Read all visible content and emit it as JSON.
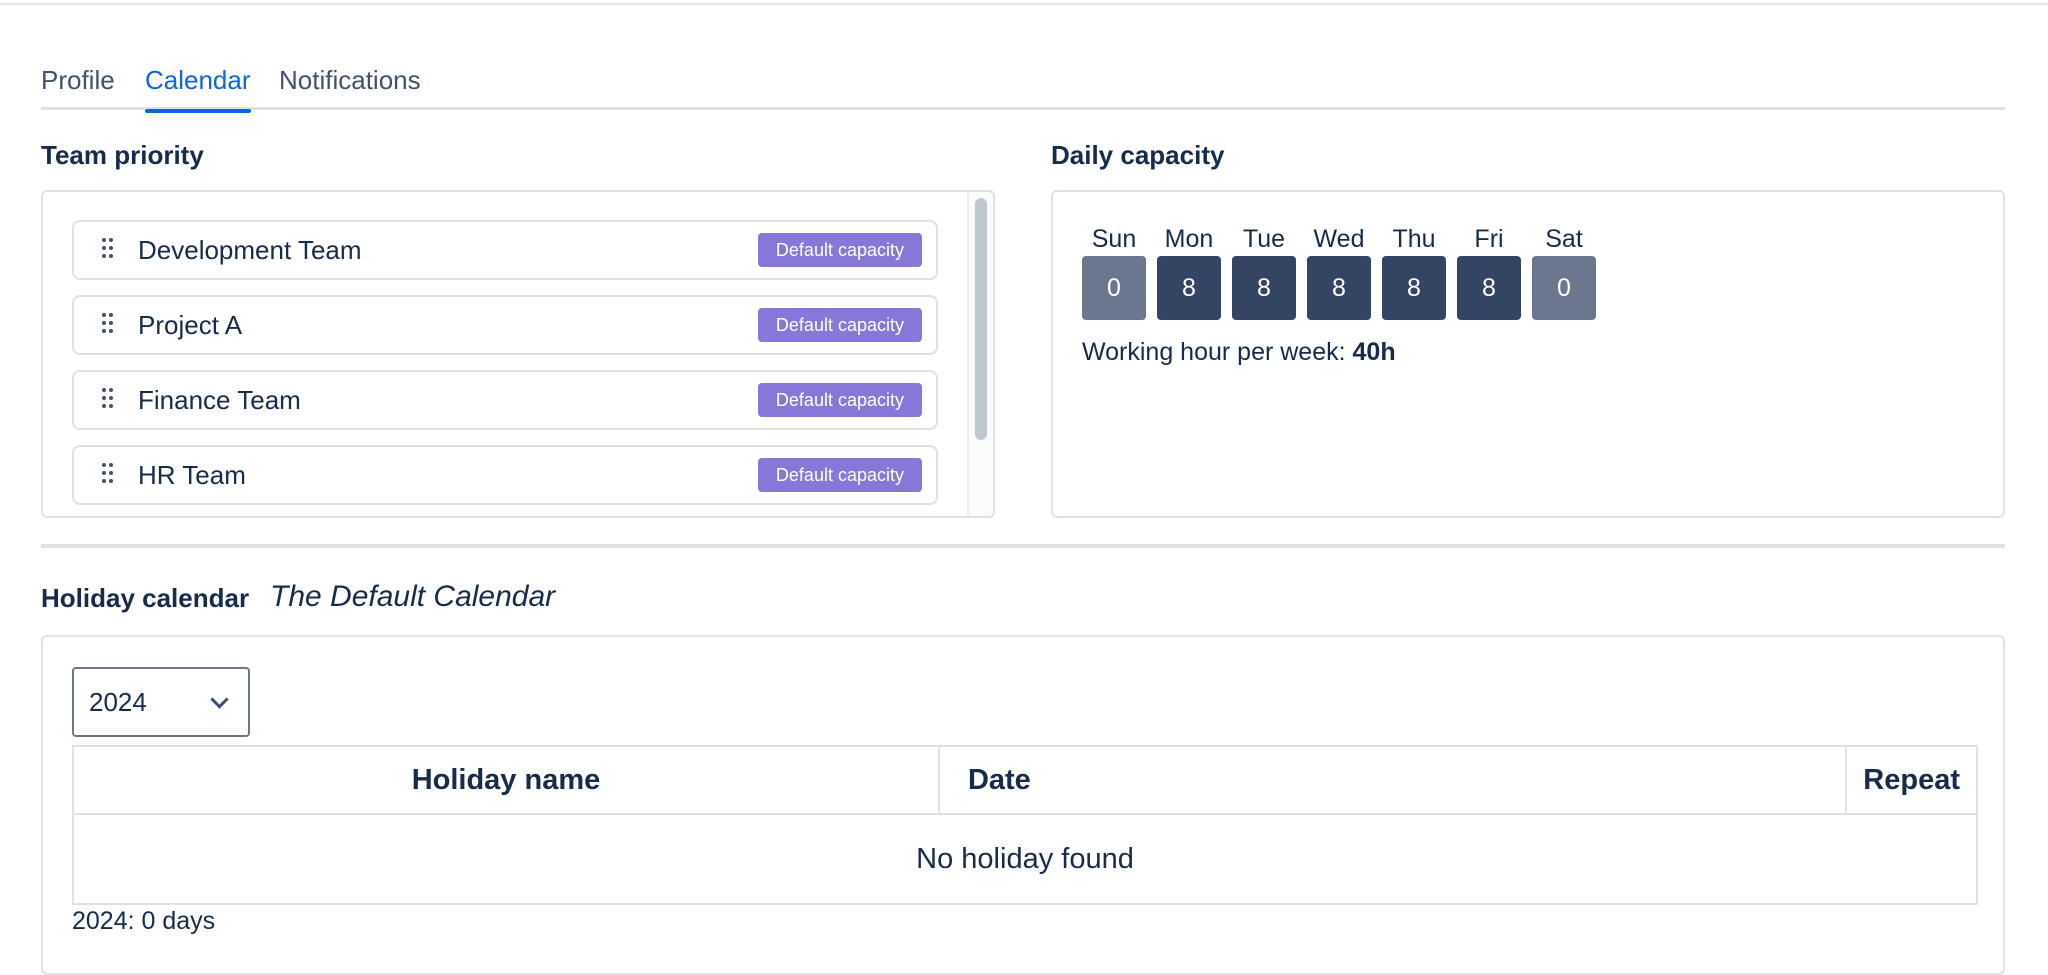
{
  "tabs": [
    "Profile",
    "Calendar",
    "Notifications"
  ],
  "team_priority": {
    "title": "Team priority",
    "teams": [
      {
        "name": "Development Team",
        "badge": "Default capacity"
      },
      {
        "name": "Project A",
        "badge": "Default capacity"
      },
      {
        "name": "Finance Team",
        "badge": "Default capacity"
      },
      {
        "name": "HR Team",
        "badge": "Default capacity"
      }
    ]
  },
  "daily_capacity": {
    "title": "Daily capacity",
    "days": [
      {
        "label": "Sun",
        "hours": "0"
      },
      {
        "label": "Mon",
        "hours": "8"
      },
      {
        "label": "Tue",
        "hours": "8"
      },
      {
        "label": "Wed",
        "hours": "8"
      },
      {
        "label": "Thu",
        "hours": "8"
      },
      {
        "label": "Fri",
        "hours": "8"
      },
      {
        "label": "Sat",
        "hours": "0"
      }
    ],
    "week_label": "Working hour per week:",
    "week_total": "40h"
  },
  "holiday": {
    "title": "Holiday calendar",
    "calendar_name": "The Default Calendar",
    "year": "2024",
    "columns": [
      "Holiday name",
      "Date",
      "Repeat"
    ],
    "empty_message": "No holiday found",
    "total": "2024: 0 days"
  }
}
